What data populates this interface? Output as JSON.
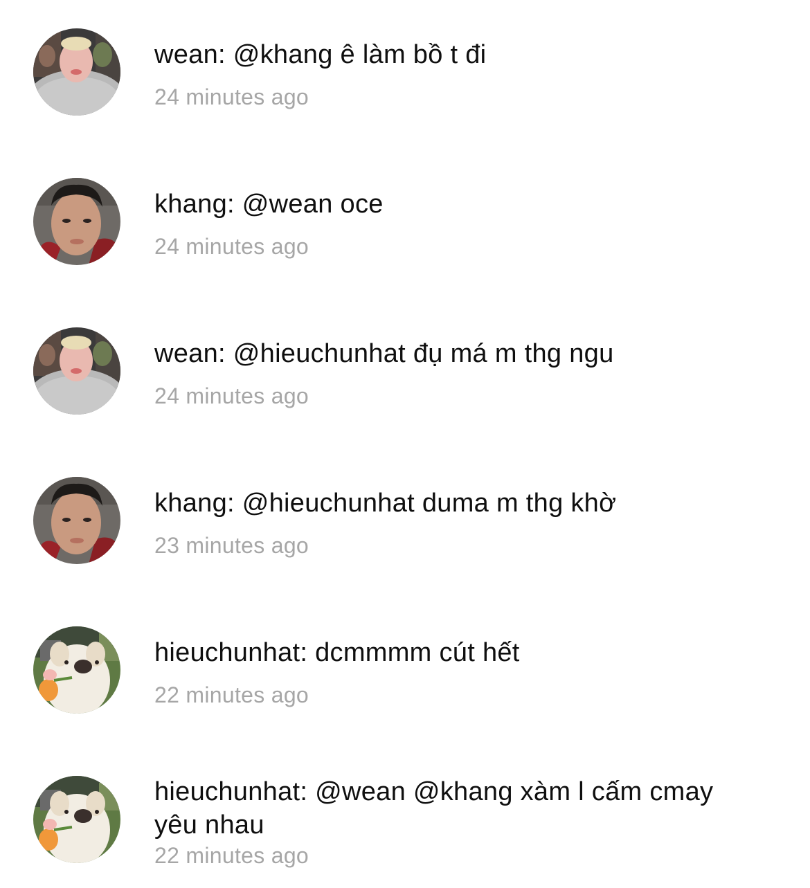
{
  "comments": [
    {
      "user": "wean",
      "text": "wean: @khang ê làm bồ t đi",
      "time": "24 minutes ago",
      "avatar": "avatar-wean"
    },
    {
      "user": "khang",
      "text": "khang: @wean oce",
      "time": "24 minutes ago",
      "avatar": "avatar-khang"
    },
    {
      "user": "wean",
      "text": "wean: @hieuchunhat đụ má m thg ngu",
      "time": "24 minutes ago",
      "avatar": "avatar-wean"
    },
    {
      "user": "khang",
      "text": "khang: @hieuchunhat duma m thg khờ",
      "time": "23 minutes ago",
      "avatar": "avatar-khang"
    },
    {
      "user": "hieuchunhat",
      "text": "hieuchunhat: dcmmmm cút hết",
      "time": "22 minutes ago",
      "avatar": "avatar-dog"
    },
    {
      "user": "hieuchunhat",
      "text": "hieuchunhat: @wean @khang xàm l cấm cmay yêu nhau",
      "time": "22 minutes ago",
      "avatar": "avatar-dog"
    }
  ]
}
